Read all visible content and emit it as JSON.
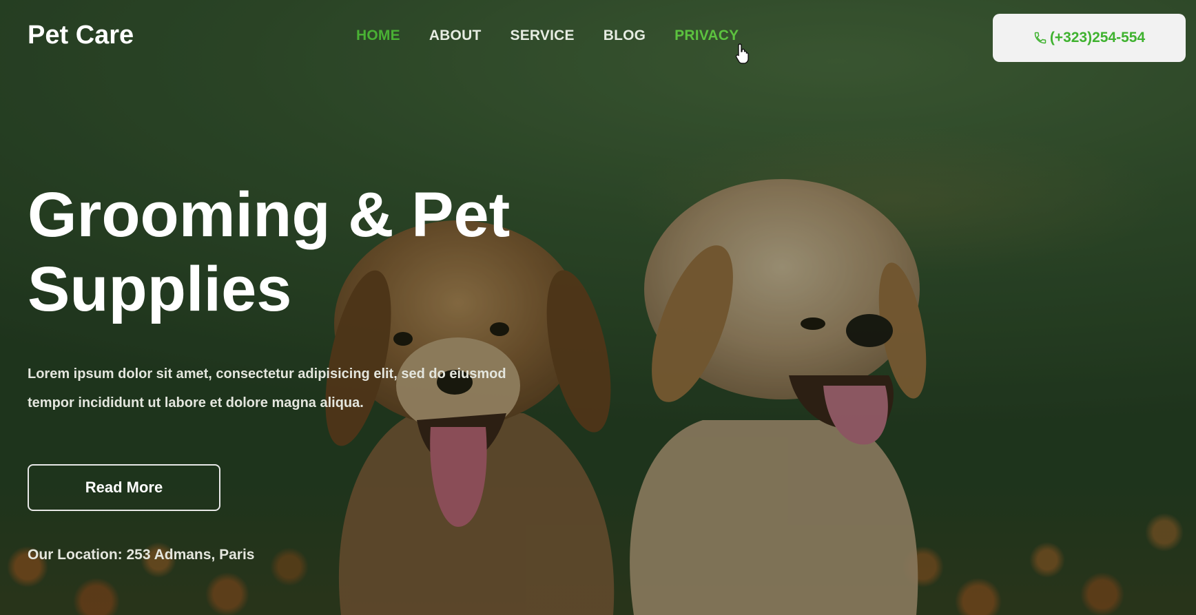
{
  "header": {
    "logo": "Pet Care",
    "nav": [
      {
        "label": "HOME",
        "state": "active"
      },
      {
        "label": "ABOUT",
        "state": "default"
      },
      {
        "label": "SERVICE",
        "state": "default"
      },
      {
        "label": "BLOG",
        "state": "default"
      },
      {
        "label": "PRIVACY",
        "state": "hover"
      }
    ],
    "phone_label": "(+323)254-554",
    "phone_icon": "phone-icon"
  },
  "hero": {
    "title_line1": "Grooming & Pet",
    "title_line2": "Supplies",
    "description_line1": "Lorem ipsum dolor sit amet, consectetur adipisicing elit, sed do eiusmod",
    "description_line2": "tempor incididunt ut labore et dolore magna aliqua.",
    "button_label": "Read More",
    "location": "Our Location: 253 Admans, Paris"
  },
  "colors": {
    "accent": "#49b134",
    "text": "#ffffff",
    "button_bg": "#f2f2f2"
  }
}
